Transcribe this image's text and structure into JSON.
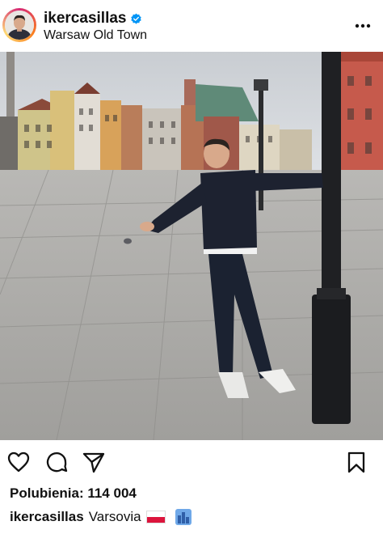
{
  "post": {
    "username": "ikercasillas",
    "location": "Warsaw Old Town",
    "likes_text": "Polubienia: 114 004",
    "caption_user": "ikercasillas",
    "caption_text": "Varsovia"
  },
  "icons": {
    "verified": "verified-badge-icon",
    "more": "more-options-icon",
    "like": "heart-icon",
    "comment": "comment-icon",
    "share": "send-icon",
    "save": "bookmark-icon",
    "flag": "poland-flag-icon",
    "city": "cityscape-icon"
  },
  "colors": {
    "verified_blue": "#0095f6",
    "text": "#111111"
  }
}
